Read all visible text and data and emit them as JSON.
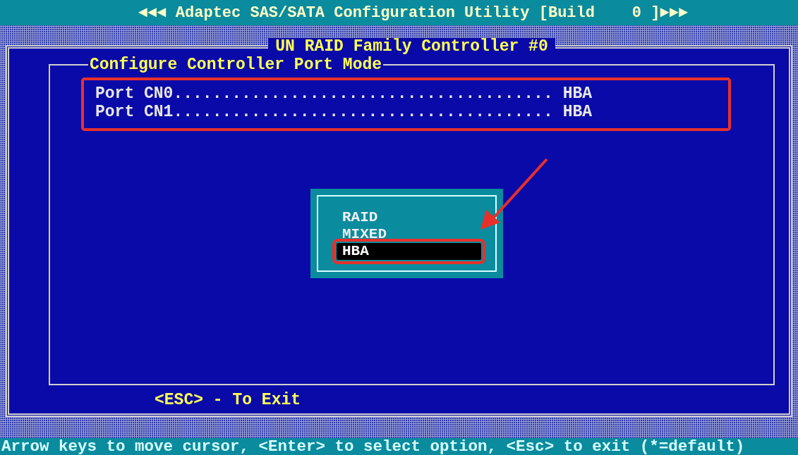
{
  "title_bar": {
    "text": "◄◄◄ Adaptec SAS/SATA Configuration Utility [Build    0 ]►►►"
  },
  "window": {
    "title": "UN RAID Family Controller #0",
    "panel": {
      "title": "Configure Controller Port Mode",
      "ports": [
        {
          "label": "Port CN0.......................................",
          "value": "HBA"
        },
        {
          "label": "Port CN1.......................................",
          "value": "HBA"
        }
      ]
    },
    "exit_hint": "<ESC> - To Exit"
  },
  "popup": {
    "options": [
      {
        "label": "RAID",
        "selected": false
      },
      {
        "label": "MIXED",
        "selected": false
      },
      {
        "label": "HBA",
        "selected": true
      }
    ]
  },
  "help_line": "Arrow keys to move cursor, <Enter> to select option, <Esc> to exit (*=default)"
}
